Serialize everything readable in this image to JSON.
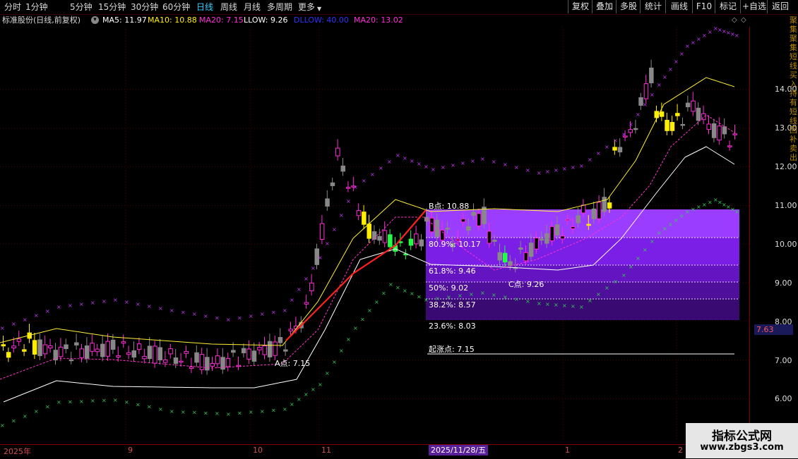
{
  "toolbar": {
    "tabs": [
      "分时",
      "1分钟",
      "5分钟",
      "15分钟",
      "30分钟",
      "60分钟",
      "日线",
      "周线",
      "月线",
      "多周期",
      "更多"
    ],
    "active_tab": "日线",
    "right_buttons": [
      "复权",
      "叠加",
      "多股",
      "统计",
      "画线",
      "F10",
      "标记",
      "+自选",
      "返回"
    ]
  },
  "info": {
    "title": "标准股份(日线,前复权)",
    "ma5": "MA5: 11.97",
    "ma10": "MA10: 10.88",
    "ma20": "MA20: 7.15",
    "llow": "LLOW: 9.26",
    "dllow": "DLLOW: 40.00",
    "ma20b": "MA20: 13.02"
  },
  "price_axis": [
    "14.00",
    "13.00",
    "12.00",
    "11.00",
    "10.00",
    "9.00",
    "8.00",
    "7.00",
    "6.00"
  ],
  "current_price": "7.63",
  "x_axis": {
    "labels": [
      "2025年",
      "9",
      "10",
      "11",
      "1",
      "2"
    ],
    "selected_date": "2025/11/28/五"
  },
  "annotations": {
    "point_a": "A点: 7.15",
    "point_b": "B点: 10.88",
    "point_c": "C点: 9.26",
    "fib_80": "80.9%: 10.17",
    "fib_618": "61.8%: 9.46",
    "fib_50": "50%: 9.02",
    "fib_382": "38.2%: 8.57",
    "fib_236": "23.6%: 8.03",
    "start": "起涨点: 7.15"
  },
  "watermark": {
    "name": "指标公式网",
    "url": "www.zbgs3.com"
  },
  "side_text": "聚集聚集短线买入持有短线回补卖出",
  "colors": {
    "up": "#ff2bd6",
    "down": "#888888",
    "yellow": "#ffee00",
    "green": "#22ff44",
    "purple": "#8f2dff"
  }
}
